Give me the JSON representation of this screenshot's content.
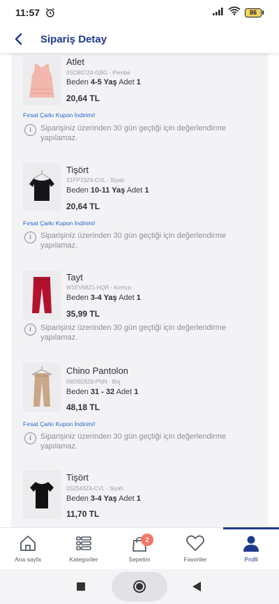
{
  "status_bar": {
    "time": "11:57",
    "battery": "86"
  },
  "header": {
    "title": "Sipariş Detay"
  },
  "labels": {
    "size_label": "Beden",
    "qty_label": "Adet"
  },
  "items": [
    {
      "name": "Atlet",
      "code": "0SO807Z4-GBG - Pembe",
      "size": "4-5 Yaş",
      "qty": "1",
      "price": "20,64 TL",
      "coupon": "Fırsat Çarkı Kupon İndirimi!",
      "note": "Siparişiniz üzerinden 30 gün geçtiği için değerlendirme yapılamaz.",
      "image": "pink-tank-top"
    },
    {
      "name": "Tişört",
      "code": "S1FP33Z4-CVL - Siyah",
      "size": "10-11 Yaş",
      "qty": "1",
      "price": "20,64 TL",
      "coupon": "Fırsat Çarkı Kupon İndirimi!",
      "note": "Siparişiniz üzerinden 30 gün geçtiği için değerlendirme yapılamaz.",
      "image": "black-tshirt-hanger"
    },
    {
      "name": "Tayt",
      "code": "W1EV68Z1-HQR - Kırmızı",
      "size": "3-4 Yaş",
      "qty": "1",
      "price": "35,99 TL",
      "coupon": "",
      "note": "Siparişiniz üzerinden 30 gün geçtiği için değerlendirme yapılamaz.",
      "image": "red-leggings"
    },
    {
      "name": "Chino Pantolon",
      "code": "0W3929Z8-PNN - Bej",
      "size": "31 - 32",
      "qty": "1",
      "price": "48,18 TL",
      "coupon": "Fırsat Çarkı Kupon İndirimi!",
      "note": "Siparişiniz üzerinden 30 gün geçtiği için değerlendirme yapılamaz.",
      "image": "beige-chino-hanger"
    },
    {
      "name": "Tişört",
      "code": "0S2543Z4-CVL - Siyah",
      "size": "3-4 Yaş",
      "qty": "1",
      "price": "11,70 TL",
      "coupon": "",
      "note": "",
      "image": "black-tshirt"
    }
  ],
  "bottom_nav": [
    {
      "label": "Ana sayfa",
      "icon": "home-icon",
      "active": false
    },
    {
      "label": "Kategoriler",
      "icon": "categories-icon",
      "active": false
    },
    {
      "label": "Sepetim",
      "icon": "cart-icon",
      "badge": "2",
      "active": false
    },
    {
      "label": "Favoriler",
      "icon": "heart-icon",
      "active": false
    },
    {
      "label": "Profil",
      "icon": "profile-icon",
      "active": true
    }
  ],
  "colors": {
    "brand": "#1f3a8a",
    "coupon": "#2563c9",
    "badge": "#f2786b",
    "panel": "#f3f3f5"
  }
}
